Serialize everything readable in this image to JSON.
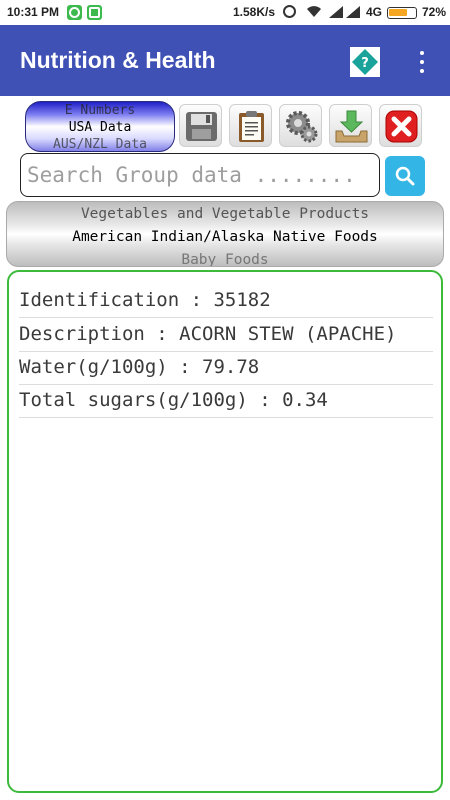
{
  "status_bar": {
    "time": "10:31 PM",
    "speed": "1.58K/s",
    "network": "4G",
    "battery": "72%",
    "battery_level": 0.72,
    "battery_color": "#f5a623"
  },
  "app_bar": {
    "title": "Nutrition & Health",
    "help_icon": "help-diamond-icon",
    "overflow_icon": "more-vert-icon",
    "color": "#3f51b5"
  },
  "toolbar": {
    "data_sources": {
      "previous": "E Numbers",
      "selected": "USA Data",
      "next": "AUS/NZL Data"
    },
    "buttons": [
      {
        "name": "save",
        "icon": "floppy-disk-icon"
      },
      {
        "name": "clipboard",
        "icon": "clipboard-icon"
      },
      {
        "name": "settings",
        "icon": "gears-icon"
      },
      {
        "name": "download",
        "icon": "download-tray-icon"
      },
      {
        "name": "close",
        "icon": "red-x-icon"
      }
    ]
  },
  "search": {
    "placeholder": "Search Group data ........",
    "value": "",
    "button_icon": "magnifier-icon",
    "button_color": "#33b5e5"
  },
  "group_picker": {
    "previous": "Vegetables and Vegetable Products",
    "selected": "American Indian/Alaska Native Foods",
    "next": "Baby Foods"
  },
  "results": {
    "border_color": "#3cba3c",
    "rows": [
      {
        "label": "Identification : 35182"
      },
      {
        "label": "Description : ACORN STEW (APACHE)"
      },
      {
        "label": "Water(g/100g) : 79.78"
      },
      {
        "label": "Total sugars(g/100g) : 0.34"
      }
    ]
  }
}
